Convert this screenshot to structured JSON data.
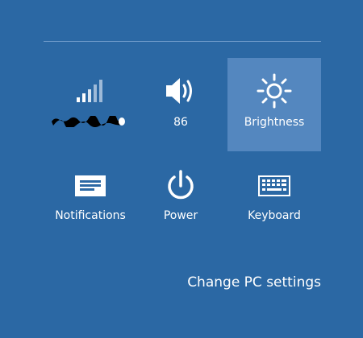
{
  "quick_settings": {
    "network": {
      "label": "",
      "icon": "signal-bars-icon"
    },
    "volume": {
      "label": "86",
      "icon": "speaker-icon"
    },
    "brightness": {
      "label": "Brightness",
      "icon": "sun-icon"
    },
    "notifications": {
      "label": "Notifications",
      "icon": "message-icon"
    },
    "power": {
      "label": "Power",
      "icon": "power-icon"
    },
    "keyboard": {
      "label": "Keyboard",
      "icon": "keyboard-icon"
    }
  },
  "footer": {
    "change_pc_settings": "Change PC settings"
  },
  "colors": {
    "background": "#2b68a4",
    "tile_selected": "#5487bf",
    "text": "#ffffff"
  }
}
